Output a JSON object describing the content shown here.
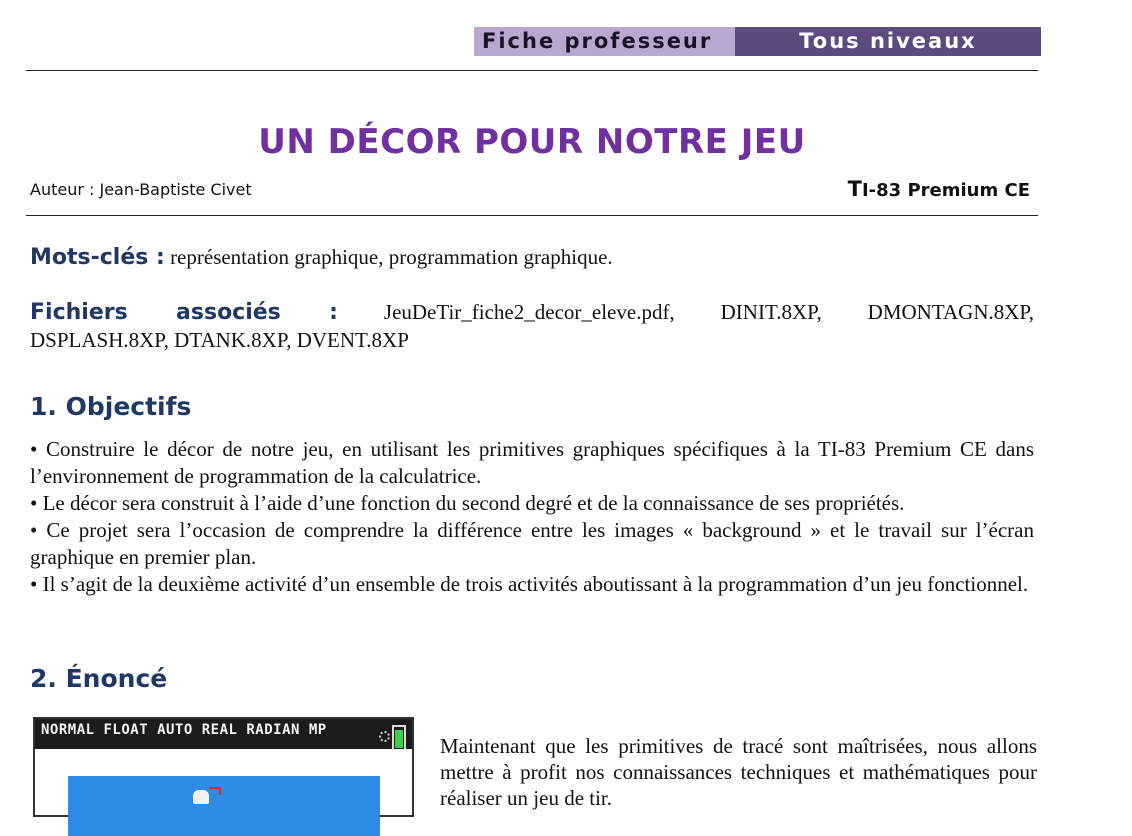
{
  "header": {
    "band_left": "Fiche professeur",
    "band_right": "Tous niveaux"
  },
  "title": "UN DÉCOR POUR NOTRE JEU",
  "author": "Auteur : Jean-Baptiste Civet",
  "model": {
    "t": "T",
    "rest": "I-83 Premium CE"
  },
  "keywords": {
    "label": "Mots-clés :",
    "text": "représentation graphique, programmation graphique."
  },
  "files": {
    "label": "Fichiers associés :",
    "line1": "JeuDeTir_fiche2_decor_eleve.pdf, DINIT.8XP, DMONTAGN.8XP,",
    "line2": "DSPLASH.8XP, DTANK.8XP, DVENT.8XP"
  },
  "section1": {
    "heading": "1. Objectifs",
    "bullets": [
      "• Construire le décor de notre jeu, en utilisant les primitives graphiques spécifiques à la TI-83 Premium CE dans l’environnement de programmation de la calculatrice.",
      "• Le décor sera construit à l’aide d’une fonction du second degré et de la connaissance de ses propriétés.",
      "• Ce projet sera l’occasion de comprendre la différence entre les images « background » et le travail sur l’écran graphique en premier plan.",
      "• Il s’agit de la deuxième activité d’un ensemble de trois activités aboutissant à la programmation d’un jeu fonctionnel."
    ]
  },
  "section2": {
    "heading": "2. Énoncé",
    "calc_status": "NORMAL FLOAT AUTO REAL RADIAN MP",
    "text": "Maintenant que les primitives de tracé sont maîtrisées, nous allons mettre à profit nos connaissances techniques et mathématiques pour réaliser un jeu de tir."
  },
  "colors": {
    "title": "#7030a0",
    "heading": "#1f3864",
    "band_light": "#b9a7cf",
    "band_dark": "#5d4a7e",
    "calc_sky": "#2f8ce6"
  }
}
